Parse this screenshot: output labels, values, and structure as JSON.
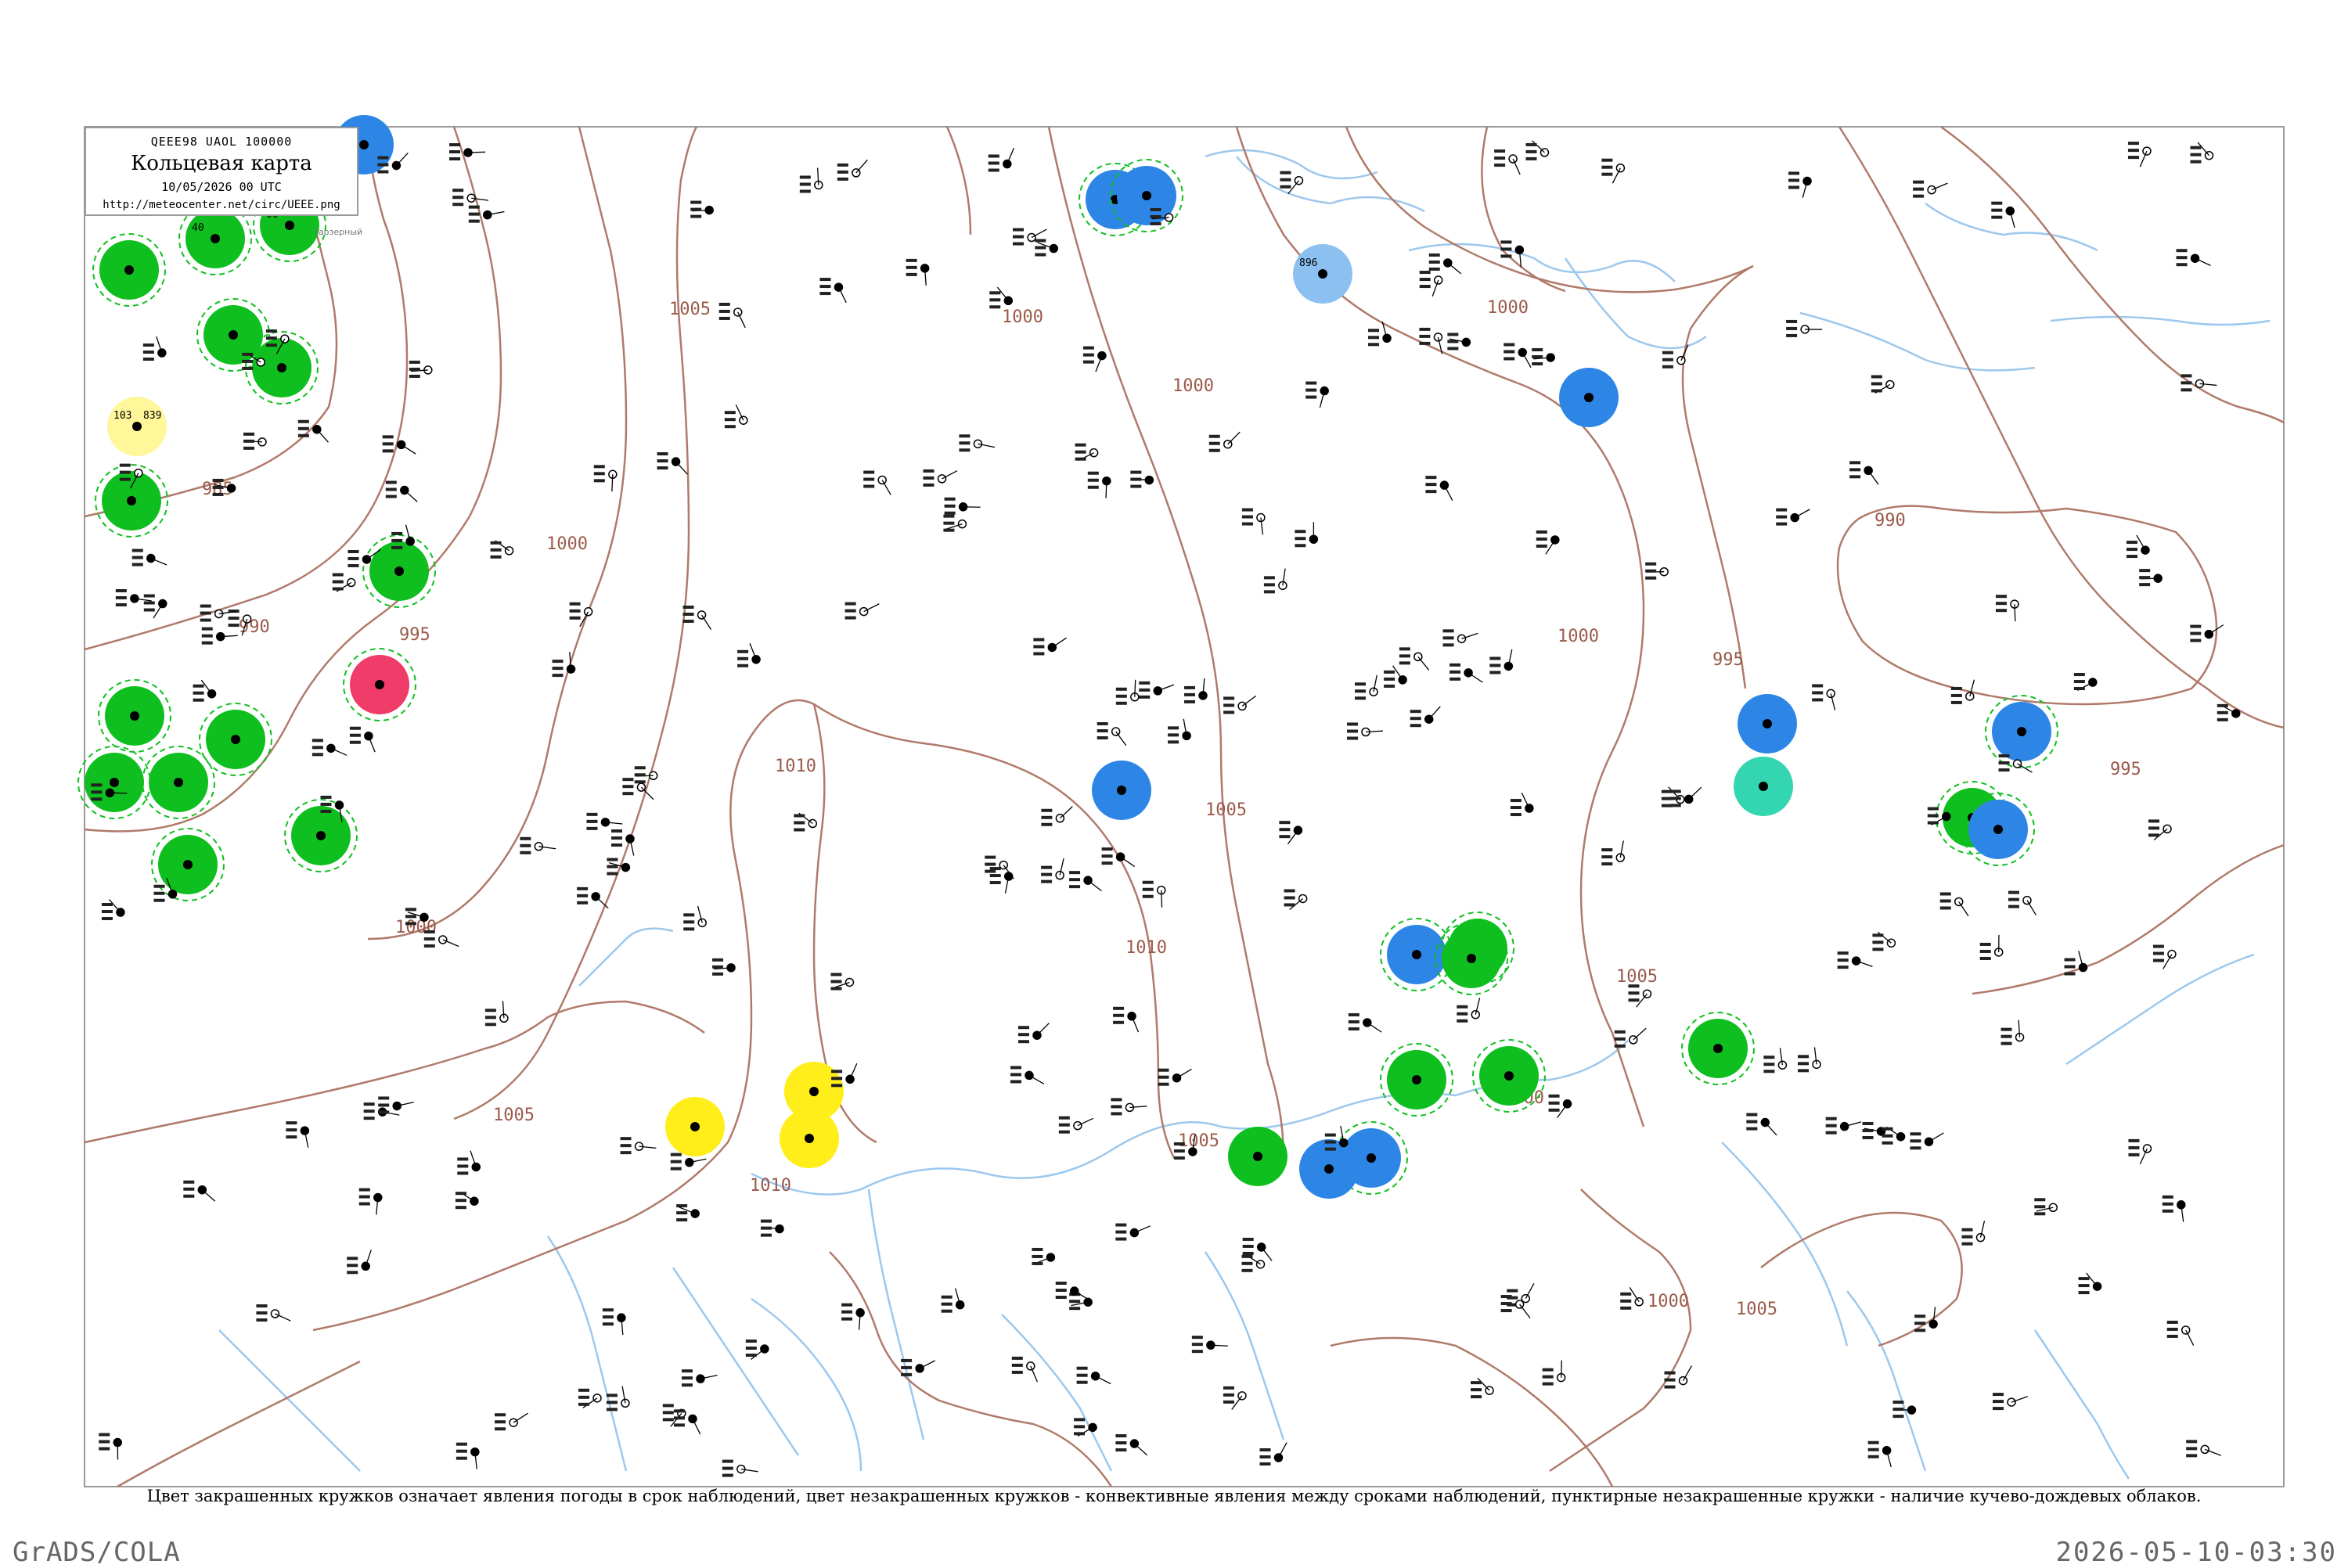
{
  "legend": {
    "code": "QEEE98  UAOL  100000",
    "title": "Кольцевая карта",
    "datetime": "10/05/2026 00 UTC",
    "url": "http://meteocenter.net/circ/UEEE.png"
  },
  "footnote": "Цвет закрашенных кружков означает явления погоды в срок наблюдений, цвет незакрашенных кружков - конвективные явления между сроками наблюдений, пунктирные незакрашенные кружки - наличие кучево-дождевых облаков.",
  "footer": {
    "left": "GrADS/COLA",
    "right": "2026-05-10-03:30"
  },
  "colors": {
    "green": "#0fbf1f",
    "blue": "#2d86e6",
    "lightblue": "#8cc0f0",
    "yellow": "#ffee1a",
    "paleyellow": "#fff79a",
    "red": "#f03c68",
    "teal": "#33d6b0",
    "isobar": "#b07a6a",
    "water": "#9cc8ee",
    "frame": "#9a9a9a"
  },
  "isobar_labels": [
    "985",
    "990",
    "995",
    "1000",
    "1005",
    "1010",
    "1000",
    "1005",
    "1000",
    "1005",
    "1010",
    "1000",
    "1005",
    "1010",
    "1000",
    "1005",
    "1000",
    "990",
    "995",
    "1000",
    "995",
    "990",
    "1000",
    "1005",
    "1000",
    "1005"
  ],
  "stations": [
    {
      "name": "Заозерный",
      "temp": "00",
      "pres": "",
      "color": "green",
      "cb": true
    },
    {
      "name": "",
      "temp": "40",
      "pres": "",
      "color": "green",
      "cb": true
    },
    {
      "name": "",
      "temp": "",
      "pres": "",
      "color": "green",
      "cb": true
    },
    {
      "name": "",
      "temp": "103",
      "pres": "839",
      "color": "paleyellow",
      "cb": false
    },
    {
      "name": "",
      "temp": "",
      "pres": "",
      "color": "green",
      "cb": true
    },
    {
      "name": "",
      "temp": "",
      "pres": "",
      "color": "green",
      "cb": true
    },
    {
      "name": "",
      "temp": "",
      "pres": "",
      "color": "green",
      "cb": true
    },
    {
      "name": "",
      "temp": "",
      "pres": "",
      "color": "blue",
      "cb": false
    },
    {
      "name": "",
      "temp": "",
      "pres": "",
      "color": "green",
      "cb": true
    },
    {
      "name": "",
      "temp": "",
      "pres": "",
      "color": "red",
      "cb": true
    },
    {
      "name": "",
      "temp": "",
      "pres": "",
      "color": "green",
      "cb": true
    },
    {
      "name": "",
      "temp": "",
      "pres": "",
      "color": "green",
      "cb": true
    },
    {
      "name": "",
      "temp": "",
      "pres": "",
      "color": "green",
      "cb": true
    },
    {
      "name": "",
      "temp": "",
      "pres": "",
      "color": "green",
      "cb": true
    },
    {
      "name": "",
      "temp": "",
      "pres": "",
      "color": "green",
      "cb": true
    },
    {
      "name": "",
      "temp": "",
      "pres": "",
      "color": "green",
      "cb": true
    },
    {
      "name": "",
      "temp": "",
      "pres": "",
      "color": "blue",
      "cb": true
    },
    {
      "name": "",
      "temp": "",
      "pres": "",
      "color": "blue",
      "cb": true
    },
    {
      "name": "",
      "temp": "",
      "pres": "",
      "color": "blue",
      "cb": false
    },
    {
      "name": "",
      "temp": "896",
      "pres": "",
      "color": "lightblue",
      "cb": false
    },
    {
      "name": "",
      "temp": "",
      "pres": "",
      "color": "blue",
      "cb": false
    },
    {
      "name": "",
      "temp": "",
      "pres": "",
      "color": "blue",
      "cb": false
    },
    {
      "name": "",
      "temp": "",
      "pres": "",
      "color": "green",
      "cb": true
    },
    {
      "name": "",
      "temp": "",
      "pres": "",
      "color": "blue",
      "cb": true
    },
    {
      "name": "",
      "temp": "",
      "pres": "",
      "color": "green",
      "cb": true
    },
    {
      "name": "",
      "temp": "",
      "pres": "",
      "color": "blue",
      "cb": true
    },
    {
      "name": "",
      "temp": "",
      "pres": "",
      "color": "green",
      "cb": true
    },
    {
      "name": "",
      "temp": "",
      "pres": "",
      "color": "green",
      "cb": true
    },
    {
      "name": "",
      "temp": "",
      "pres": "",
      "color": "blue",
      "cb": true
    },
    {
      "name": "",
      "temp": "",
      "pres": "",
      "color": "teal",
      "cb": false
    },
    {
      "name": "",
      "temp": "",
      "pres": "",
      "color": "blue",
      "cb": true
    },
    {
      "name": "",
      "temp": "",
      "pres": "",
      "color": "yellow",
      "cb": false
    },
    {
      "name": "",
      "temp": "",
      "pres": "",
      "color": "yellow",
      "cb": false
    },
    {
      "name": "",
      "temp": "",
      "pres": "",
      "color": "yellow",
      "cb": false
    },
    {
      "name": "",
      "temp": "",
      "pres": "",
      "color": "green",
      "cb": false
    },
    {
      "name": "",
      "temp": "",
      "pres": "",
      "color": "green",
      "cb": true
    },
    {
      "name": "",
      "temp": "",
      "pres": "",
      "color": "green",
      "cb": true
    },
    {
      "name": "",
      "temp": "",
      "pres": "",
      "color": "blue",
      "cb": false
    }
  ]
}
